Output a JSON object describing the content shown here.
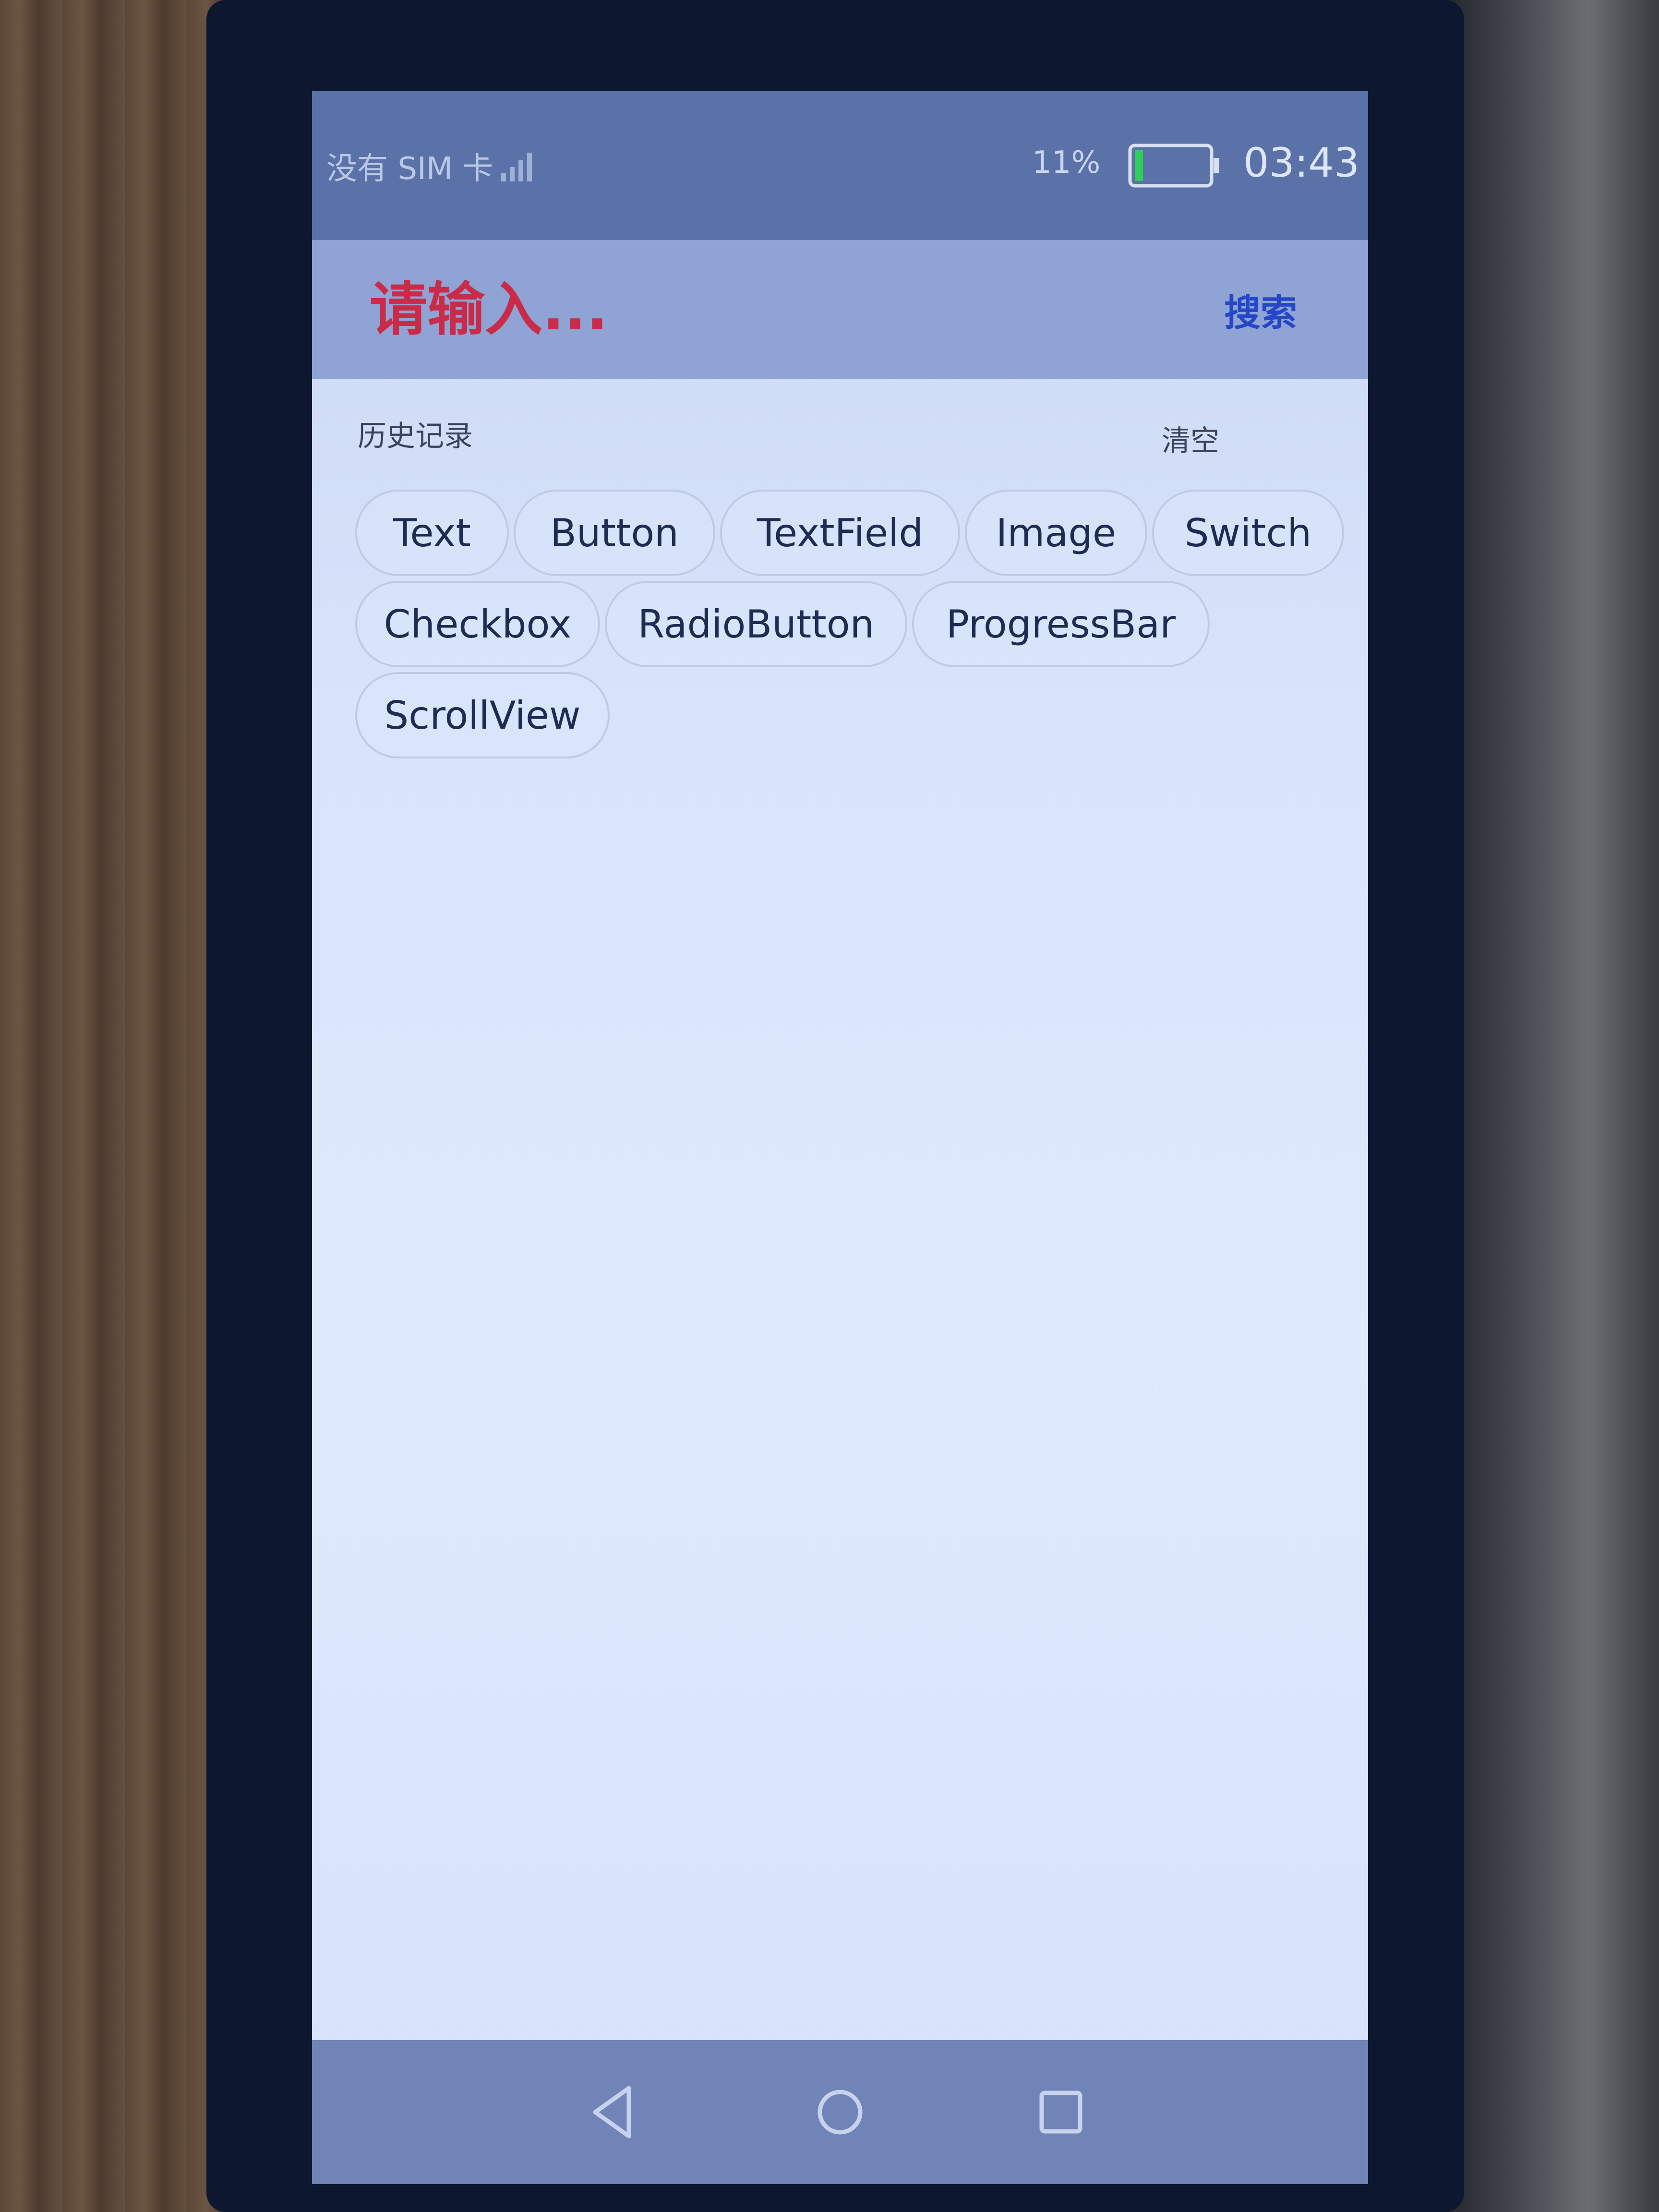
{
  "status_bar": {
    "sim_status": "没有 SIM 卡",
    "battery_percent": "11%",
    "battery_level": 0.11,
    "time": "03:43"
  },
  "search": {
    "placeholder": "请输入...",
    "button_label": "搜索"
  },
  "history": {
    "title": "历史记录",
    "clear_label": "清空",
    "items": [
      "Text",
      "Button",
      "TextField",
      "Image",
      "Switch",
      "Checkbox",
      "RadioButton",
      "ProgressBar",
      "ScrollView"
    ]
  },
  "colors": {
    "placeholder": "#c92b48",
    "search_button": "#2447c8",
    "battery_fill": "#2fd05a"
  },
  "nav": {
    "icons": [
      "back-icon",
      "home-icon",
      "recents-icon"
    ]
  }
}
